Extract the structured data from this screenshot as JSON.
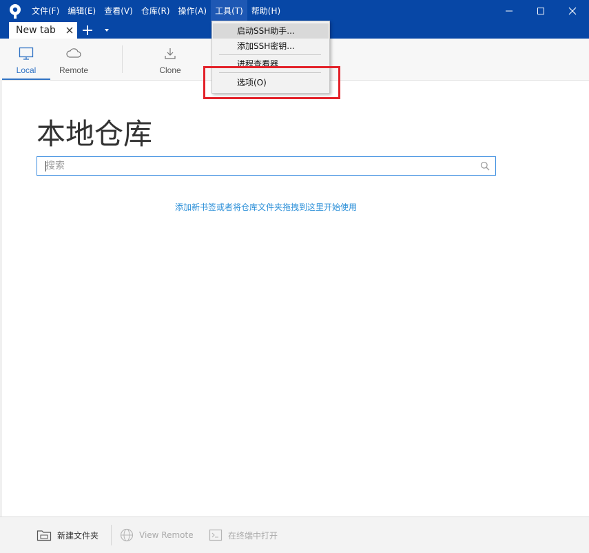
{
  "menu": [
    "文件(F)",
    "编辑(E)",
    "查看(V)",
    "仓库(R)",
    "操作(A)",
    "工具(T)",
    "帮助(H)"
  ],
  "tab": {
    "label": "New tab"
  },
  "toolbar": {
    "local": "Local",
    "remote": "Remote",
    "clone": "Clone"
  },
  "main": {
    "title": "本地仓库",
    "search_placeholder": "搜索",
    "hint": "添加新书签或者将仓库文件夹拖拽到这里开始使用"
  },
  "tools_menu": {
    "items": [
      "启动SSH助手...",
      "添加SSH密钥...",
      "进程查看器",
      "选项(O)"
    ]
  },
  "footer": {
    "new_folder": "新建文件夹",
    "view_remote": "View Remote",
    "open_terminal": "在终端中打开"
  },
  "colors": {
    "titlebar": "#0747a6",
    "accent": "#2f72c4",
    "highlight_box": "#e3222a"
  }
}
